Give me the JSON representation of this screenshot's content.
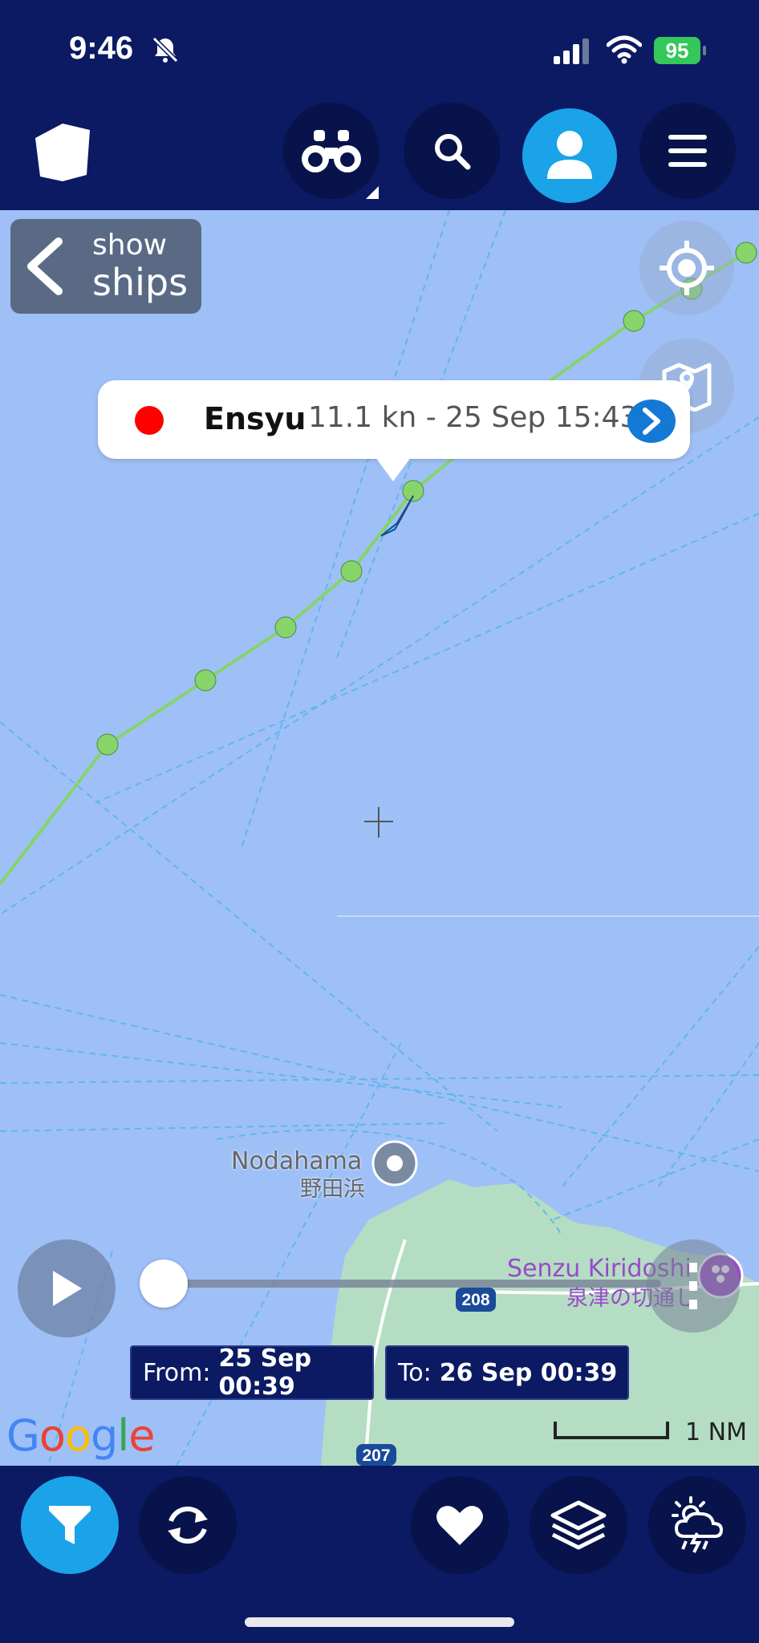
{
  "status_bar": {
    "time": "9:46",
    "battery": "95"
  },
  "map": {
    "show_ships": {
      "line1": "show",
      "line2": "ships"
    },
    "popup": {
      "vessel_name": "Ensyu",
      "info": "11.1 kn - 25 Sep 15:43",
      "status_color": "#ff0000"
    },
    "places": [
      {
        "name": "Nodahama",
        "name_jp": "野田浜"
      },
      {
        "name": "Senzu Kiridoshi",
        "name_jp": "泉津の切通し"
      }
    ],
    "road_labels": [
      "208",
      "207"
    ],
    "google_logo": "Google",
    "scale": "1 NM"
  },
  "playback": {
    "from_label": "From:",
    "from_value": "25 Sep 00:39",
    "to_label": "To:",
    "to_value": "26 Sep 00:39",
    "progress": 0
  },
  "colors": {
    "header_bg": "#0b1a63",
    "accent": "#1aa3e8",
    "sea": "#9ec0f7",
    "land": "#b4ddc4",
    "track": "#86d46a"
  },
  "icons": {
    "header": [
      "logo-icon",
      "binoculars-icon",
      "search-icon",
      "user-icon",
      "menu-icon"
    ],
    "bottom": [
      "filter-icon",
      "refresh-icon",
      "heart-icon",
      "layers-icon",
      "weather-icon"
    ]
  }
}
